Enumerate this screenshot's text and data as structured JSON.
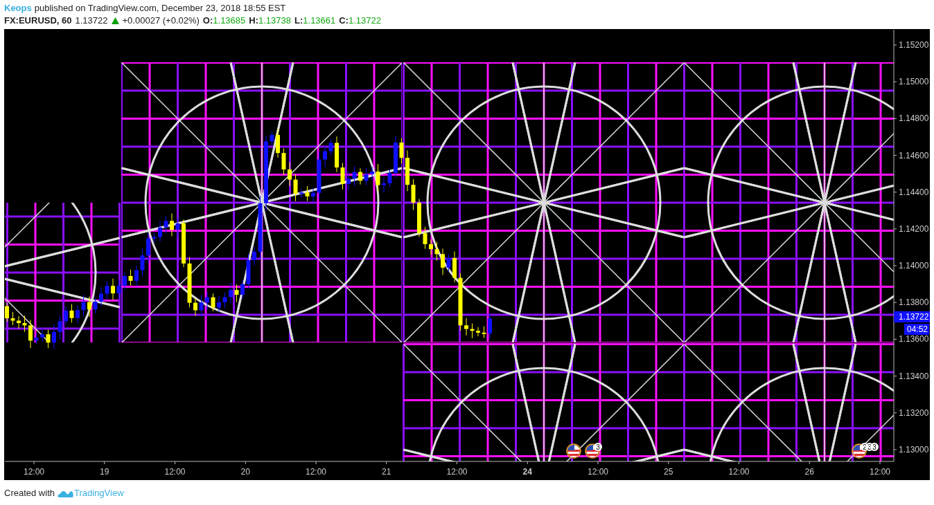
{
  "header": {
    "author": "Keops",
    "published": "published on TradingView.com, December 23, 2018 18:55 EST"
  },
  "symbol": {
    "name": "FX:EURUSD, 60",
    "last": "1.13722",
    "rising": true,
    "change": "+0.00027 (+0.02%)",
    "ohlc": [
      {
        "key": "O:",
        "value": "1.13685"
      },
      {
        "key": "H:",
        "value": "1.13738"
      },
      {
        "key": "L:",
        "value": "1.13661"
      },
      {
        "key": "C:",
        "value": "1.13722"
      }
    ]
  },
  "chart": {
    "price_ticks": [
      "1.15200",
      "1.15000",
      "1.14800",
      "1.14600",
      "1.14400",
      "1.14200",
      "1.14000",
      "1.13800",
      "1.13600",
      "1.13400",
      "1.13200",
      "1.13000"
    ],
    "current_price": "1.13722",
    "countdown": "04:52",
    "time_ticks": [
      {
        "label": "12:00",
        "bold": false
      },
      {
        "label": "19",
        "bold": false
      },
      {
        "label": "12:00",
        "bold": false
      },
      {
        "label": "20",
        "bold": false
      },
      {
        "label": "12:00",
        "bold": false
      },
      {
        "label": "21",
        "bold": false
      },
      {
        "label": "12:00",
        "bold": false
      },
      {
        "label": "24",
        "bold": true
      },
      {
        "label": "12:00",
        "bold": false
      },
      {
        "label": "25",
        "bold": false
      },
      {
        "label": "12:00",
        "bold": false
      },
      {
        "label": "26",
        "bold": false
      },
      {
        "label": "12:00",
        "bold": false
      }
    ],
    "events": [
      {
        "kind": "flag"
      },
      {
        "kind": "flag",
        "counts": [
          "3"
        ]
      },
      {
        "kind": "flag",
        "counts": [
          "2",
          "3",
          "3"
        ]
      }
    ]
  },
  "footer": {
    "text": "Created with",
    "brand": "TradingView"
  }
}
